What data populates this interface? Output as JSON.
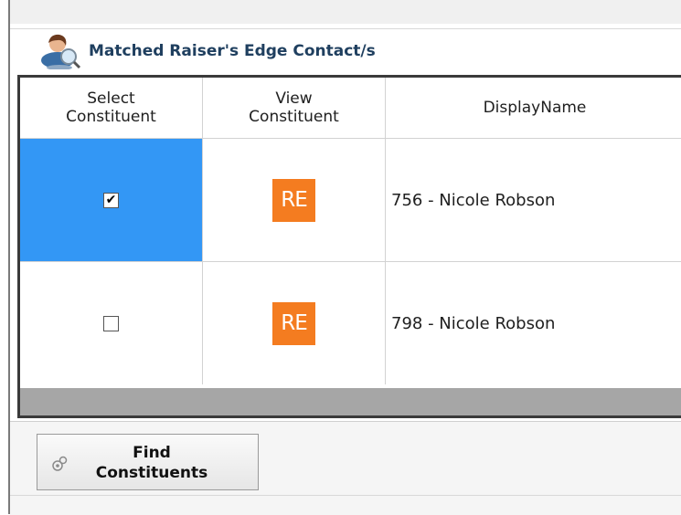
{
  "panel": {
    "title": "Matched Raiser's Edge Contact/s"
  },
  "grid": {
    "columns": [
      {
        "label": "Select\nConstituent"
      },
      {
        "label": "View\nConstituent"
      },
      {
        "label": "DisplayName"
      }
    ],
    "rows": [
      {
        "checked": true,
        "checkmark": "✔",
        "badge": "RE",
        "display_name": "756 - Nicole Robson",
        "selected": true
      },
      {
        "checked": false,
        "checkmark": "",
        "badge": "RE",
        "display_name": "798 - Nicole Robson",
        "selected": false
      }
    ]
  },
  "actions": {
    "find_label": "Find\nConstituents"
  },
  "colors": {
    "selected_row": "#3397f5",
    "re_badge": "#f47c20",
    "title_text": "#1f3f5f"
  },
  "icons": {
    "header_icon": "person-search-icon",
    "find_icon": "find-gear-icon",
    "view_badge": "raisers-edge-badge-icon"
  }
}
